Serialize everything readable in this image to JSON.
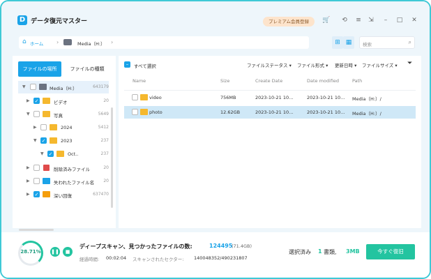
{
  "app": {
    "title": "データ復元マスター",
    "premium_label": "プレミアム会員登録"
  },
  "address": {
    "home_label": "ホーム",
    "current": "Media（H:）"
  },
  "search": {
    "placeholder": "検索"
  },
  "left_tabs": {
    "location": "ファイルの場所",
    "type": "ファイルの種類"
  },
  "tree": [
    {
      "name": "Media（H:）",
      "count": "643179"
    },
    {
      "name": "ビデオ",
      "count": "20"
    },
    {
      "name": "写真",
      "count": "5649"
    },
    {
      "name": "2024",
      "count": "5412"
    },
    {
      "name": "2023",
      "count": "237"
    },
    {
      "name": "Oct..",
      "count": "237"
    },
    {
      "name": "削除済みファイル",
      "count": "20"
    },
    {
      "name": "失われたファイル名",
      "count": "20"
    },
    {
      "name": "深い回復",
      "count": "637470"
    }
  ],
  "toolbar": {
    "select_all": "すべて選択",
    "filters": [
      "ファイルステータス",
      "ファイル形式",
      "更新日時",
      "ファイルサイズ"
    ]
  },
  "table": {
    "headers": [
      "Name",
      "Size",
      "Create Date",
      "Date modified",
      "Path"
    ],
    "rows": [
      {
        "name": "video",
        "size": "756MB",
        "create": "2023-10-21 10…",
        "modified": "2023-10-21 10…",
        "path": "Media（H:）/"
      },
      {
        "name": "photo",
        "size": "12.62GB",
        "create": "2023-10-21 10…",
        "modified": "2023-10-21 10…",
        "path": "Media（H:）/"
      }
    ]
  },
  "status": {
    "progress_percent": "28.71%",
    "progress_value": 28.71,
    "main_label": "ディープスキャン、見つかったファイルの数:",
    "found_count": "124495",
    "found_size": "(71.4GB)",
    "elapsed_label": "経過時間:",
    "elapsed_value": "00:02:04",
    "sectors_label": "スキャンされたセクター:",
    "sectors_value": "140048352/490231807"
  },
  "selection": {
    "label": "選択済み",
    "count": "1",
    "unit": "書類,",
    "size": "3MB",
    "recover_button": "今すぐ復旧"
  },
  "colors": {
    "accent": "#1aa3e8",
    "success": "#23c4a0",
    "border": "#3fc9d6"
  }
}
